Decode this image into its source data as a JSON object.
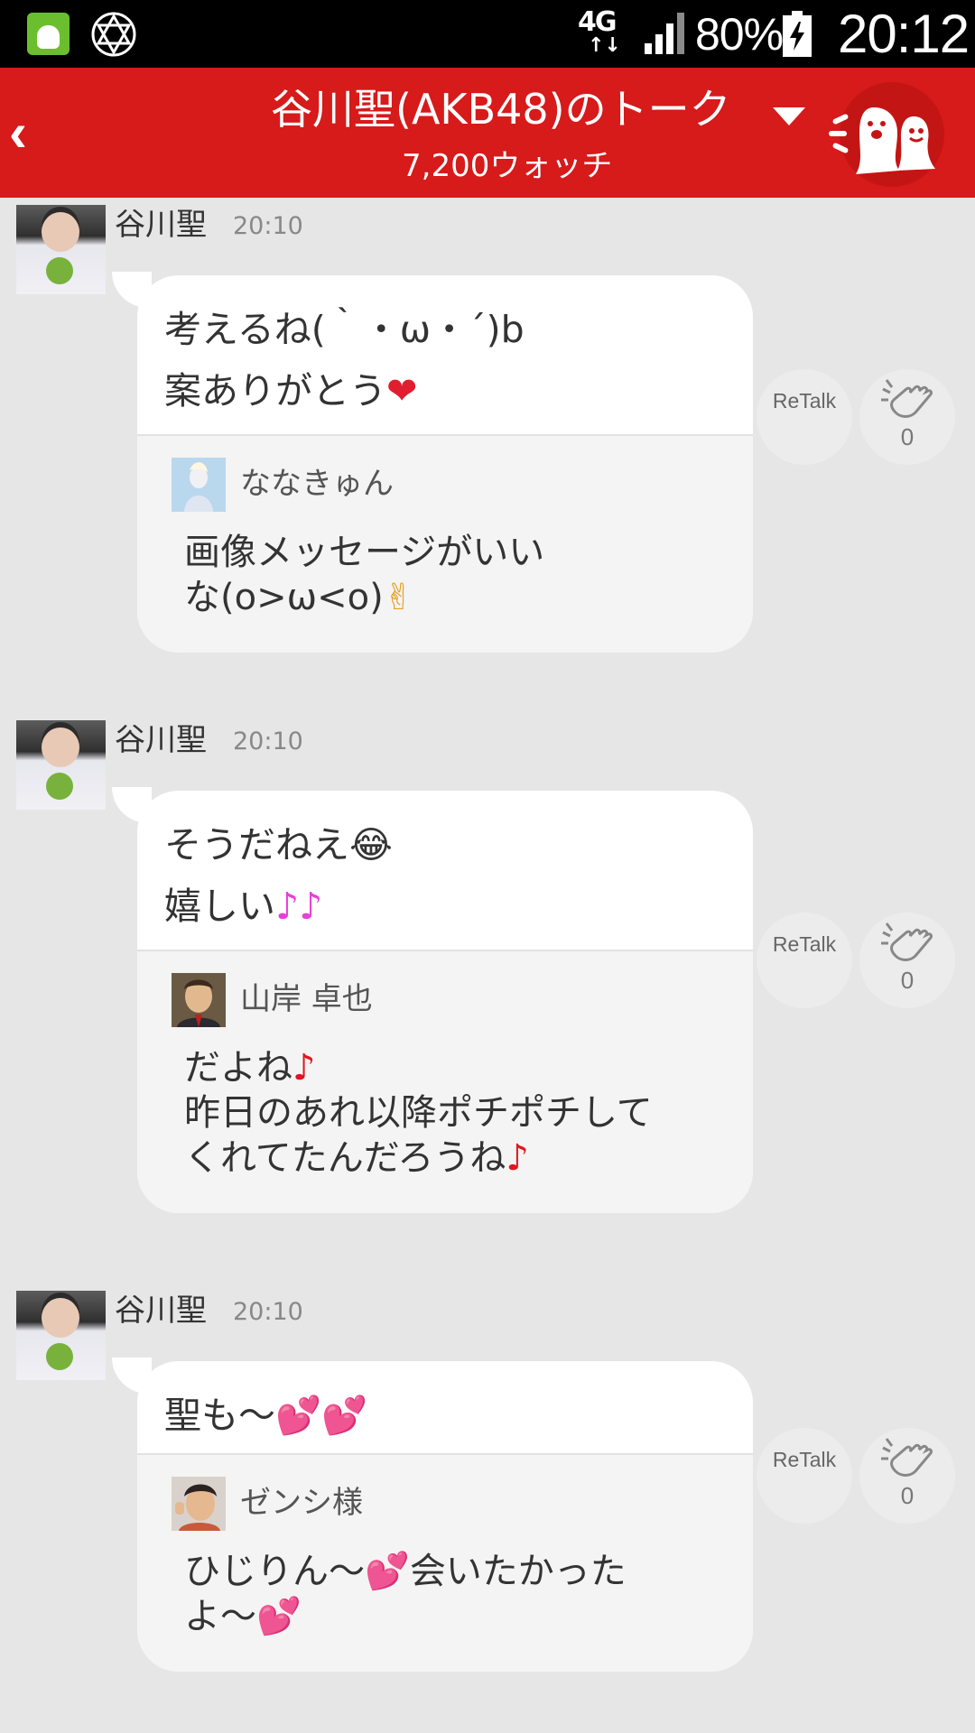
{
  "status_bar": {
    "network": "4G",
    "network_arrows": "↑↓",
    "battery": "80%",
    "time": "20:12"
  },
  "header": {
    "back": "‹",
    "title": "谷川聖(AKB48)のトーク",
    "watch_count": "7,200ウォッチ"
  },
  "messages": [
    {
      "sender": "谷川聖",
      "time": "20:10",
      "lines": [
        "考えるね(｀・ω・´)b",
        "案ありがとう"
      ],
      "line_emoji": [
        "",
        "❤"
      ],
      "quote": {
        "user": "ななきゅん",
        "lines": [
          "画像メッセージがいい",
          "な(o>ω<o)"
        ],
        "line_emoji": [
          "",
          "✌"
        ]
      },
      "retalk": "ReTalk",
      "claps": "0"
    },
    {
      "sender": "谷川聖",
      "time": "20:10",
      "lines": [
        "そうだねえ",
        "嬉しい"
      ],
      "line_emoji": [
        "😂",
        "♪♪"
      ],
      "quote": {
        "user": "山岸 卓也",
        "lines": [
          "だよね",
          "昨日のあれ以降ポチポチして",
          "くれてたんだろうね"
        ],
        "line_emoji": [
          "♪",
          "",
          "♪"
        ]
      },
      "retalk": "ReTalk",
      "claps": "0"
    },
    {
      "sender": "谷川聖",
      "time": "20:10",
      "lines": [
        "聖も〜"
      ],
      "line_emoji": [
        "💕💕"
      ],
      "quote": {
        "user": "ゼンシ様",
        "lines": [
          "ひじりん〜",
          "よ〜"
        ],
        "line_emoji": [
          "💕",
          "💕"
        ],
        "lines_tail": [
          "会いたかった",
          ""
        ]
      },
      "retalk": "ReTalk",
      "claps": "0"
    }
  ],
  "colors": {
    "header_red": "#d71a1a",
    "background": "#e6e6e6",
    "bubble": "#ffffff",
    "quote_bg": "#f4f4f4"
  }
}
